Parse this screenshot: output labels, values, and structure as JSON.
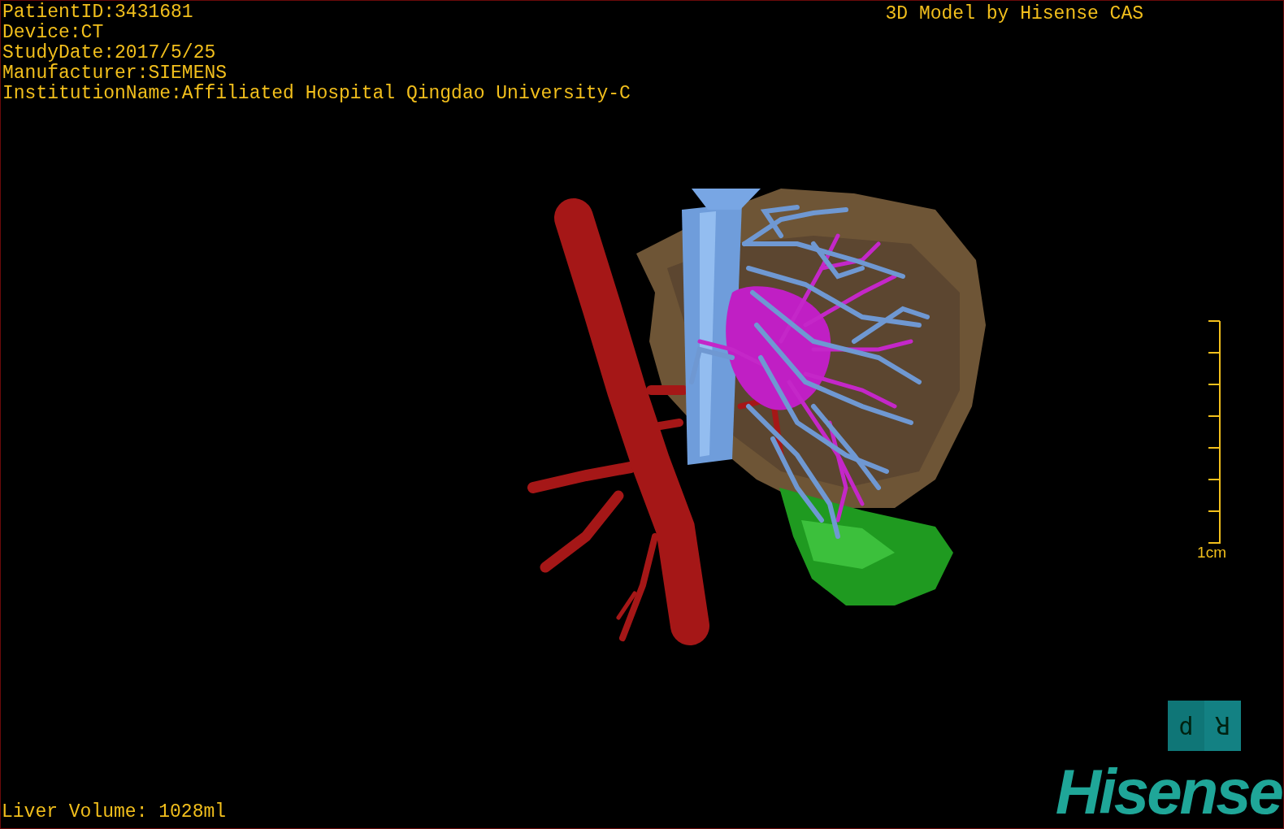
{
  "patient_info": [
    "PatientID:3431681",
    "Device:CT",
    "StudyDate:2017/5/25",
    "Manufacturer:SIEMENS",
    "InstitutionName:Affiliated Hospital Qingdao University-C"
  ],
  "title": "3D Model by Hisense CAS",
  "scale_bar": {
    "label": "1cm"
  },
  "liver_volume": "Liver Volume: 1028ml",
  "orientation_cube": {
    "faces": [
      "d",
      "R"
    ]
  },
  "logo": "Hisense"
}
